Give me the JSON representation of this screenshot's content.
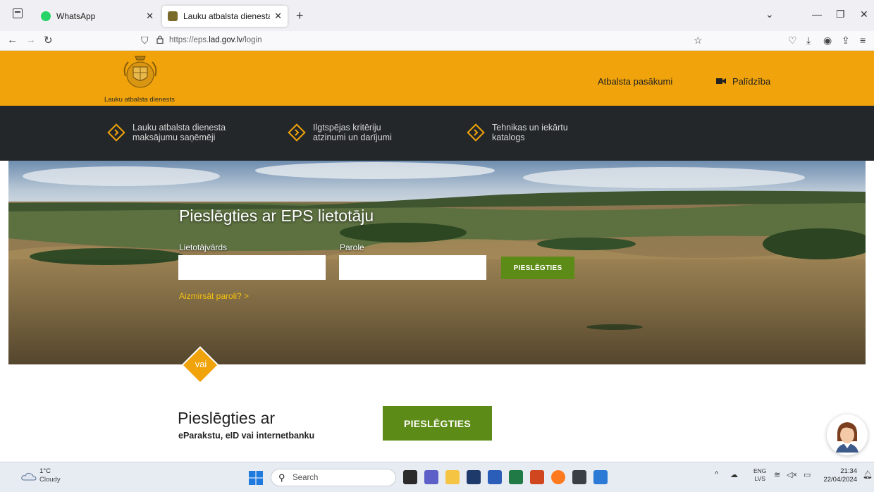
{
  "browser": {
    "tabs": [
      {
        "title": "WhatsApp",
        "favicon": "whatsapp-icon",
        "active": false
      },
      {
        "title": "Lauku atbalsta dienesta E-pietei",
        "favicon": "lad-crest-icon",
        "active": true
      }
    ],
    "url_prefix": "https://eps.",
    "url_domain": "lad.gov.lv",
    "url_path": "/login"
  },
  "header": {
    "logo_text": "Lauku atbalsta dienests",
    "nav": [
      {
        "label": "Atbalsta pasākumi"
      },
      {
        "label": "Palīdzība",
        "icon": "video-camera-icon"
      }
    ]
  },
  "menu": [
    {
      "line1": "Lauku atbalsta dienesta",
      "line2": "maksājumu saņēmēji"
    },
    {
      "line1": "Ilgtspējas kritēriju",
      "line2": "atzinumi un darījumi"
    },
    {
      "line1": "Tehnikas un iekārtu",
      "line2": "katalogs"
    }
  ],
  "login": {
    "title": "Pieslēgties ar EPS lietotāju",
    "username_label": "Lietotājvārds",
    "username_value": "",
    "password_label": "Parole",
    "password_value": "",
    "submit_label": "PIESLĒGTIES",
    "forgot_label": "Aizmirsāt paroli?  >"
  },
  "alt_login": {
    "or_label": "vai",
    "title": "Pieslēgties ar",
    "subtitle": "eParakstu, eID vai internetbanku",
    "button_label": "PIESLĒGTIES"
  },
  "taskbar": {
    "weather_temp": "1°C",
    "weather_cond": "Cloudy",
    "search_label": "Search",
    "lang_line1": "ENG",
    "lang_line2": "LVS",
    "time": "21:34",
    "date": "22/04/2024"
  },
  "colors": {
    "brand_orange": "#f0a30a",
    "dark_menu": "#232729",
    "green_button": "#5d8b17",
    "link_yellow": "#f4c20d"
  }
}
